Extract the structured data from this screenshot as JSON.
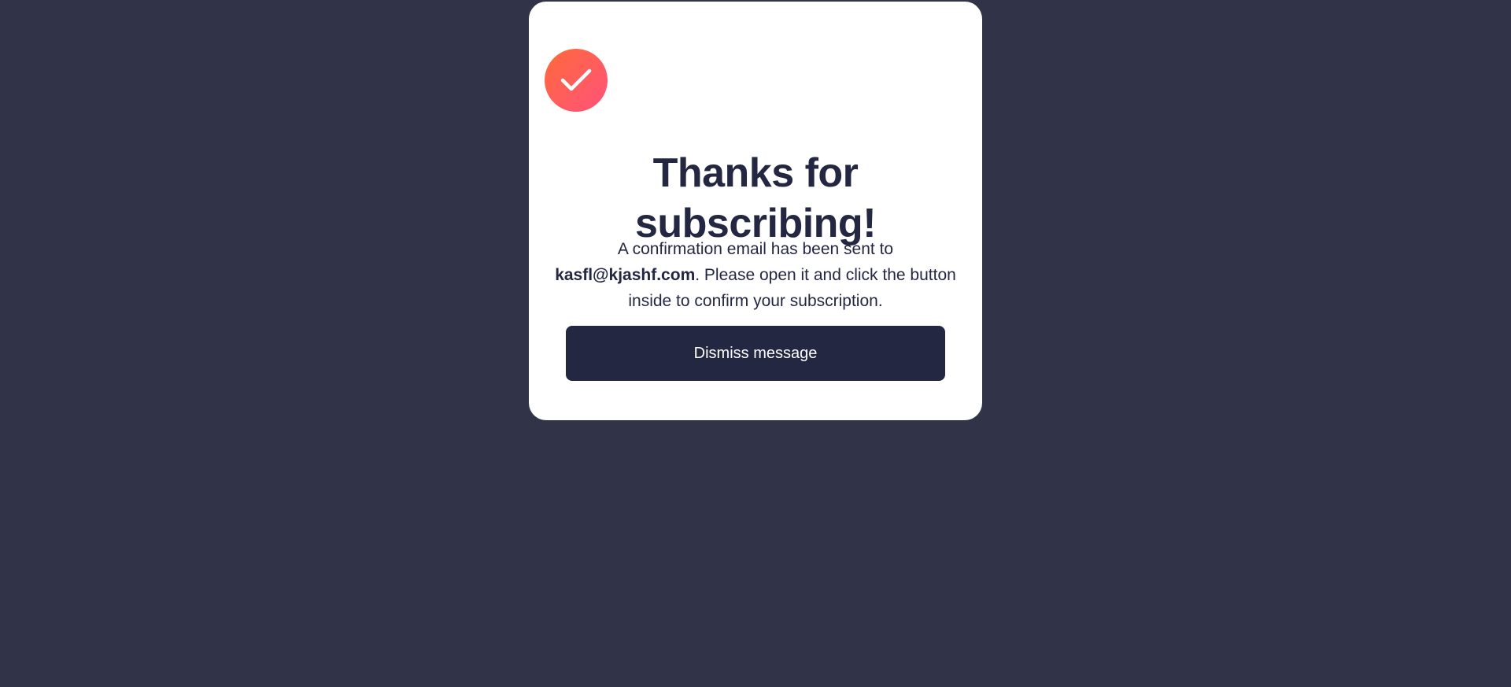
{
  "colors": {
    "background": "#313448",
    "card": "#ffffff",
    "dark_navy": "#242742",
    "accent_gradient_start": "#ff6a3a",
    "accent_gradient_end": "#ff527b"
  },
  "success": {
    "icon": "check-icon",
    "title": "Thanks for subscribing!",
    "message_prefix": "A confirmation email has been sent to ",
    "email": "kasfl@kjashf.com",
    "message_suffix": ". Please open it and click the button inside to confirm your subscription.",
    "dismiss_label": "Dismiss message"
  }
}
